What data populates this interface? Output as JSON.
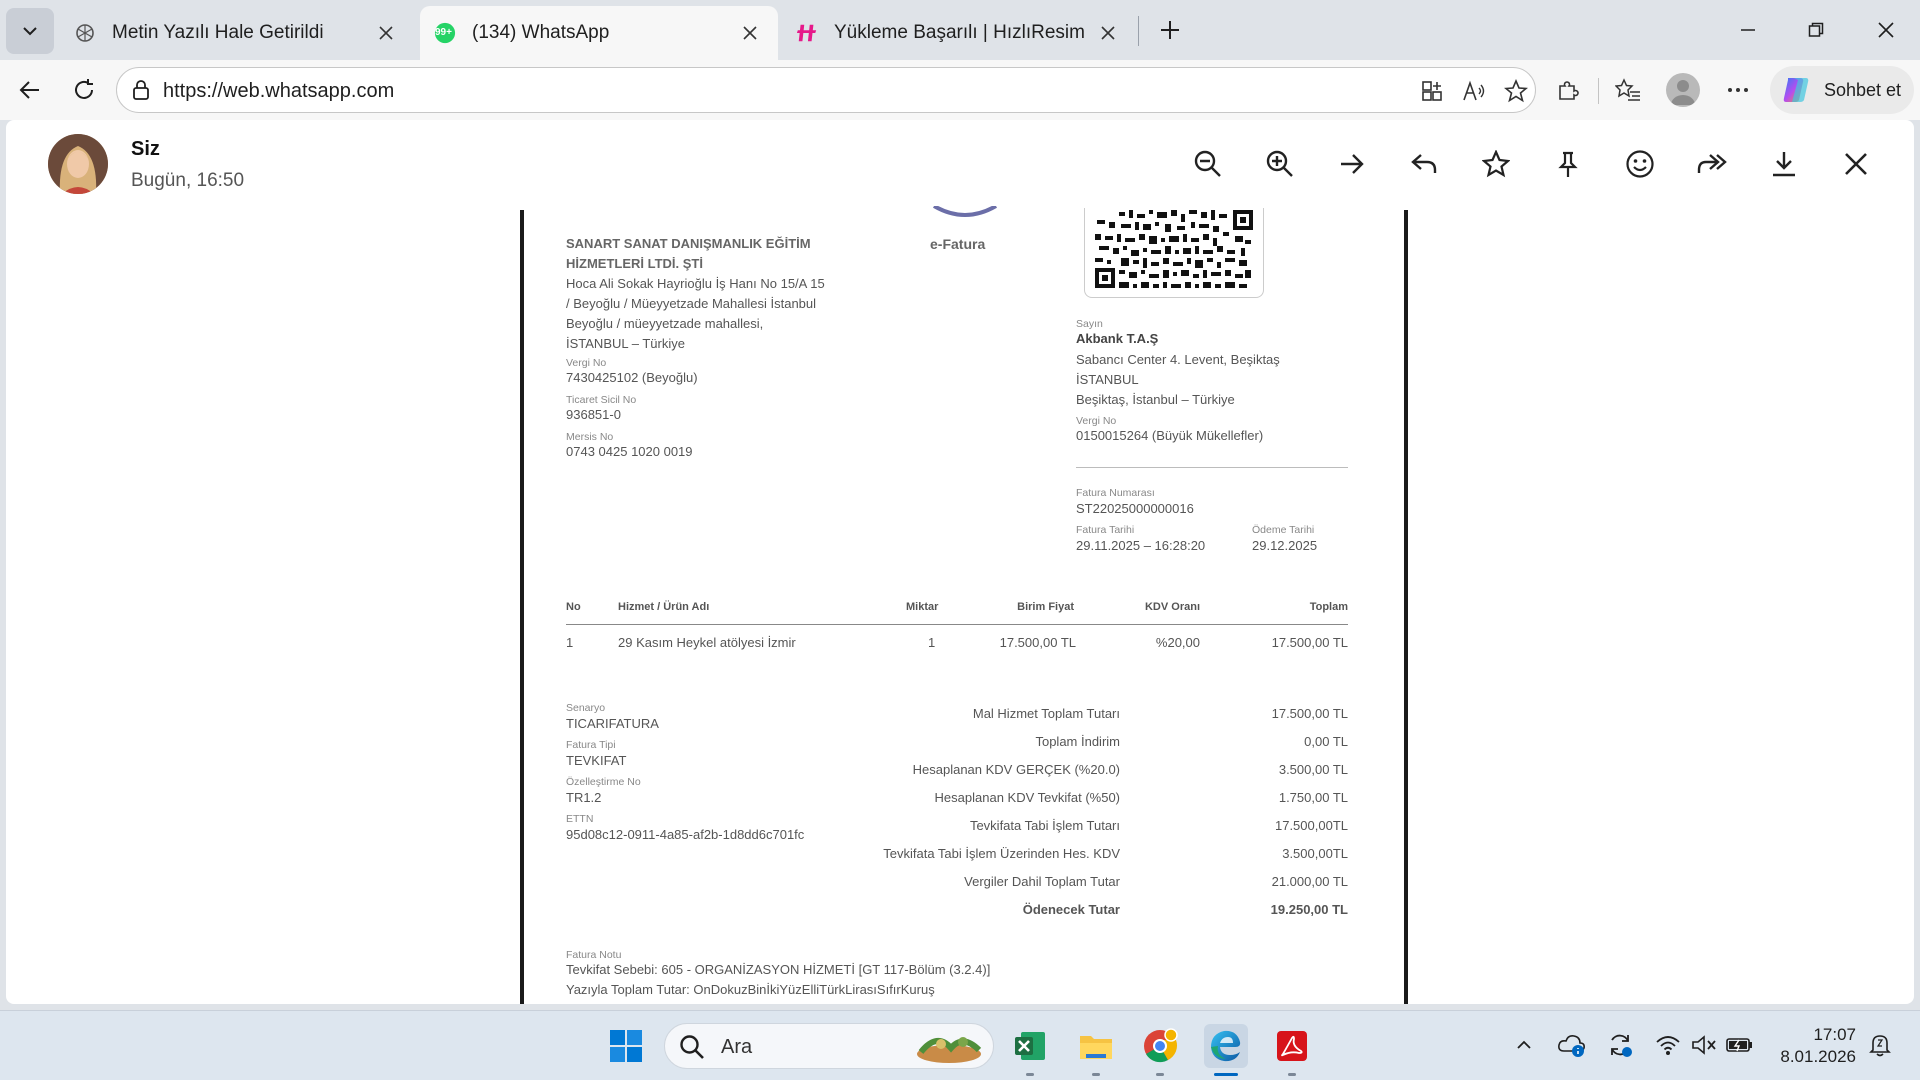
{
  "browser": {
    "tabs": [
      {
        "title": "Metin Yazılı Hale Getirildi",
        "icon": "chatgpt-icon",
        "active": false
      },
      {
        "title": "(134) WhatsApp",
        "icon": "whatsapp-icon",
        "badge": "99+",
        "active": true
      },
      {
        "title": "Yükleme Başarılı | HızlıResim",
        "icon": "hizliresim-icon",
        "active": false
      }
    ],
    "url": "https://web.whatsapp.com",
    "copilot_label": "Sohbet et"
  },
  "viewer": {
    "sender_name": "Siz",
    "timestamp": "Bugün, 16:50"
  },
  "invoice": {
    "doc_type": "e-Fatura",
    "seller": {
      "name_line1": "SANART SANAT DANIŞMANLIK EĞİTİM",
      "name_line2": "HİZMETLERİ LTDİ. ŞTİ",
      "address_lines": [
        "Hoca Ali Sokak Hayrioğlu İş Hanı No 15/A 15",
        "/ Beyoğlu / Müeyyetzade Mahallesi İstanbul",
        "Beyoğlu / müeyyetzade mahallesi,",
        "İSTANBUL – Türkiye"
      ],
      "vergi_label": "Vergi No",
      "vergi_value": "7430425102 (Beyoğlu)",
      "ticaret_label": "Ticaret Sicil No",
      "ticaret_value": "936851-0",
      "mersis_label": "Mersis No",
      "mersis_value": "0743 0425 1020 0019"
    },
    "buyer": {
      "sayin_label": "Sayın",
      "name": "Akbank T.A.Ş",
      "address_lines": [
        "Sabancı Center 4. Levent, Beşiktaş",
        "İSTANBUL",
        "Beşiktaş, İstanbul – Türkiye"
      ],
      "vergi_label": "Vergi No",
      "vergi_value": "0150015264 (Büyük Mükellefler)"
    },
    "meta": {
      "fatura_no_label": "Fatura Numarası",
      "fatura_no": "ST22025000000016",
      "fatura_tarihi_label": "Fatura Tarihi",
      "fatura_tarihi": "29.11.2025 – 16:28:20",
      "odeme_tarihi_label": "Ödeme Tarihi",
      "odeme_tarihi": "29.12.2025"
    },
    "table": {
      "headers": [
        "No",
        "Hizmet / Ürün Adı",
        "Miktar",
        "Birim Fiyat",
        "KDV Oranı",
        "Toplam"
      ],
      "rows": [
        [
          "1",
          "29 Kasım Heykel atölyesi İzmir",
          "1",
          "17.500,00 TL",
          "%20,00",
          "17.500,00 TL"
        ]
      ]
    },
    "details": {
      "senaryo_label": "Senaryo",
      "senaryo": "TICARIFATURA",
      "tip_label": "Fatura Tipi",
      "tip": "TEVKIFAT",
      "ozel_label": "Özelleştirme No",
      "ozel": "TR1.2",
      "ettn_label": "ETTN",
      "ettn": "95d08c12-0911-4a85-af2b-1d8dd6c701fc"
    },
    "totals": [
      {
        "label": "Mal Hizmet Toplam Tutarı",
        "value": "17.500,00 TL"
      },
      {
        "label": "Toplam İndirim",
        "value": "0,00 TL"
      },
      {
        "label": "Hesaplanan KDV GERÇEK (%20.0)",
        "value": "3.500,00 TL"
      },
      {
        "label": "Hesaplanan KDV Tevkifat (%50)",
        "value": "1.750,00 TL"
      },
      {
        "label": "Tevkifata Tabi İşlem Tutarı",
        "value": "17.500,00TL"
      },
      {
        "label": "Tevkifata Tabi İşlem Üzerinden Hes. KDV",
        "value": "3.500,00TL"
      },
      {
        "label": "Vergiler Dahil Toplam Tutar",
        "value": "21.000,00 TL"
      },
      {
        "label": "Ödenecek Tutar",
        "value": "19.250,00 TL"
      }
    ],
    "note": {
      "label": "Fatura Notu",
      "line1": "Tevkifat Sebebi: 605 - ORGANİZASYON HİZMETİ [GT 117-Bölüm (3.2.4)]",
      "line2": "Yazıyla Toplam Tutar: OnDokuzBinİkiYüzElliTürkLirasıSıfırKuruş"
    }
  },
  "taskbar": {
    "search_placeholder": "Ara",
    "time": "17:07",
    "date": "8.01.2026"
  },
  "colors": {
    "edge_blue": "#0067c0",
    "whatsapp_green": "#25d366",
    "hizliresim_pink": "#e6198a",
    "excel_green": "#1d6f42",
    "acrobat_red": "#d7141a"
  }
}
